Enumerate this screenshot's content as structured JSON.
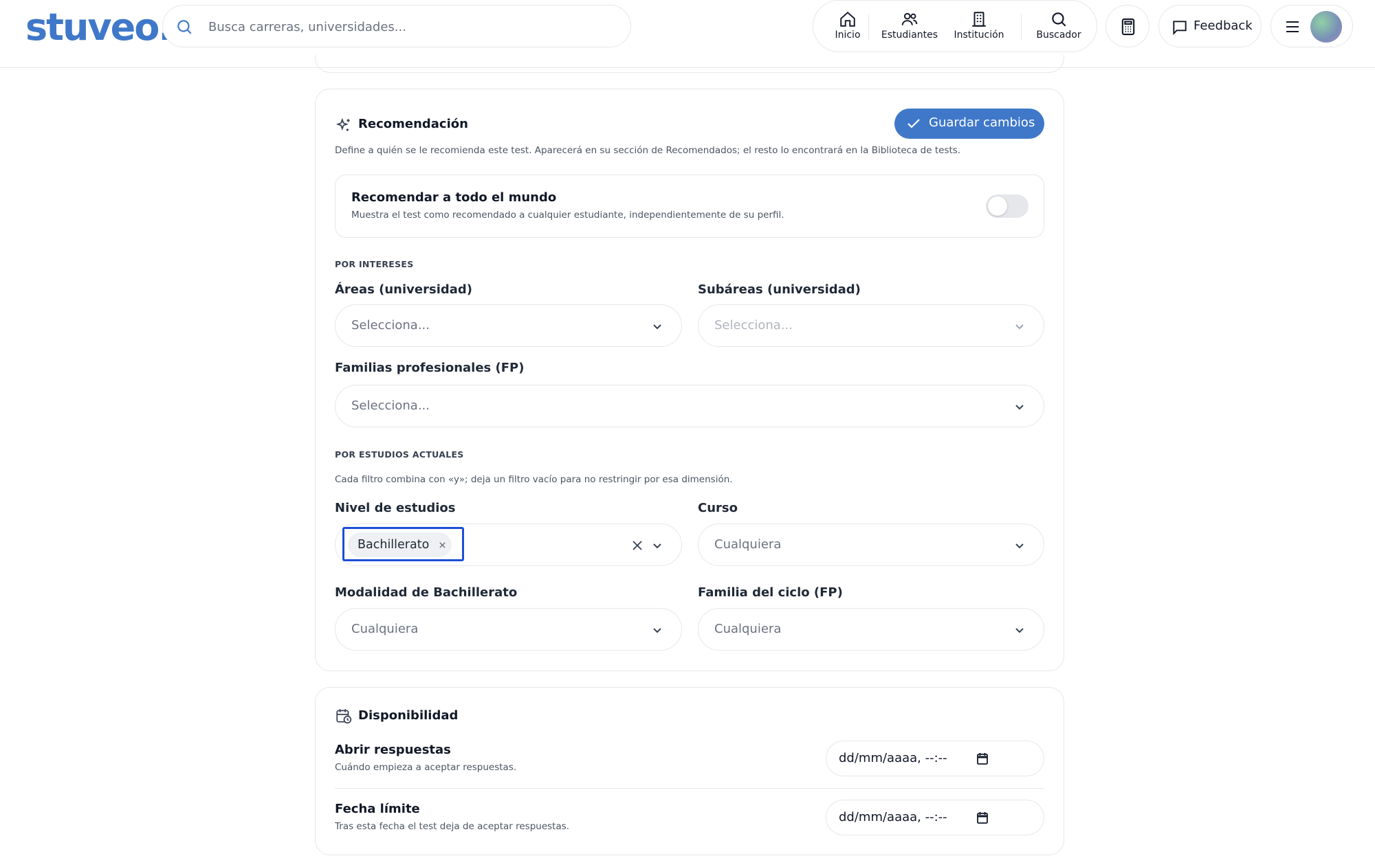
{
  "brand": {
    "logo": "stuveo.",
    "color": "#3f78c9"
  },
  "search": {
    "placeholder": "Busca carreras, universidades..."
  },
  "nav": {
    "items": [
      {
        "label": "Inicio",
        "icon": "home-icon"
      },
      {
        "label": "Estudiantes",
        "icon": "users-icon"
      },
      {
        "label": "Institución",
        "icon": "building-icon"
      },
      {
        "label": "Buscador",
        "icon": "search-icon"
      }
    ],
    "feedback_label": "Feedback"
  },
  "recommendation": {
    "title": "Recomendación",
    "description": "Define a quién se le recomienda este test. Aparecerá en su sección de Recomendados; el resto lo encontrará en la Biblioteca de tests.",
    "save_label": "Guardar cambios",
    "toggle": {
      "title": "Recomendar a todo el mundo",
      "description": "Muestra el test como recomendado a cualquier estudiante, independientemente de su perfil.",
      "on": false
    },
    "interests": {
      "heading": "POR INTERESES",
      "areas": {
        "label": "Áreas (universidad)",
        "placeholder": "Selecciona..."
      },
      "subareas": {
        "label": "Subáreas (universidad)",
        "placeholder": "Selecciona..."
      },
      "families": {
        "label": "Familias profesionales (FP)",
        "placeholder": "Selecciona..."
      }
    },
    "current_studies": {
      "heading": "POR ESTUDIOS ACTUALES",
      "note": "Cada filtro combina con «y»; deja un filtro vacío para no restringir por esa dimensión.",
      "level": {
        "label": "Nivel de estudios",
        "selected": [
          "Bachillerato"
        ]
      },
      "course": {
        "label": "Curso",
        "value": "Cualquiera"
      },
      "modality": {
        "label": "Modalidad de Bachillerato",
        "value": "Cualquiera"
      },
      "cycle_family": {
        "label": "Familia del ciclo (FP)",
        "value": "Cualquiera"
      }
    }
  },
  "availability": {
    "title": "Disponibilidad",
    "open": {
      "title": "Abrir respuestas",
      "description": "Cuándo empieza a aceptar respuestas.",
      "value": "dd/mm/aaaa, --:--"
    },
    "deadline": {
      "title": "Fecha límite",
      "description": "Tras esta fecha el test deja de aceptar respuestas.",
      "value": "dd/mm/aaaa, --:--"
    }
  }
}
